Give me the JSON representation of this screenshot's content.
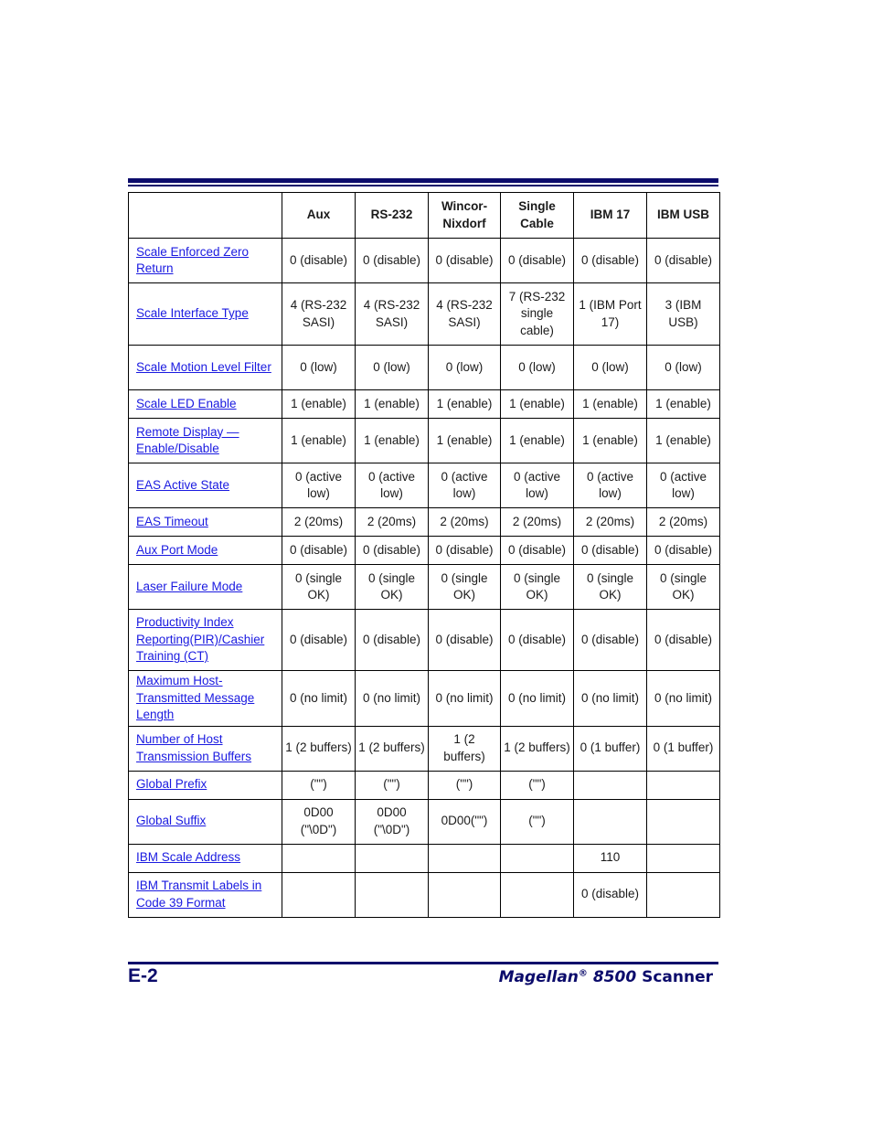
{
  "table": {
    "columns": [
      "",
      "Aux",
      "RS-232",
      "Wincor-\nNixdorf",
      "Single\nCable",
      "IBM 17",
      "IBM USB"
    ],
    "rows": [
      {
        "name": "Scale Enforced Zero Return",
        "values": [
          "0 (disable)",
          "0 (disable)",
          "0 (disable)",
          "0 (disable)",
          "0 (disable)",
          "0 (disable)"
        ]
      },
      {
        "name": "Scale Interface Type",
        "values": [
          "4 (RS-232 SASI)",
          "4 (RS-232 SASI)",
          "4 (RS-232 SASI)",
          "7 (RS-232 single cable)",
          "1 (IBM Port 17)",
          "3 (IBM USB)"
        ]
      },
      {
        "name": "Scale Motion Level Filter",
        "values": [
          "0 (low)",
          "0 (low)",
          "0 (low)",
          "0 (low)",
          "0 (low)",
          "0 (low)"
        ]
      },
      {
        "name": "Scale LED Enable",
        "values": [
          "1 (enable)",
          "1 (enable)",
          "1 (enable)",
          "1 (enable)",
          "1 (enable)",
          "1 (enable)"
        ]
      },
      {
        "name": "Remote Display — Enable/Disable",
        "values": [
          "1 (enable)",
          "1 (enable)",
          "1 (enable)",
          "1 (enable)",
          "1 (enable)",
          "1 (enable)"
        ]
      },
      {
        "name": "EAS Active State",
        "values": [
          "0 (active low)",
          "0 (active low)",
          "0 (active low)",
          "0 (active low)",
          "0 (active low)",
          "0 (active low)"
        ]
      },
      {
        "name": "EAS Timeout",
        "values": [
          "2 (20ms)",
          "2 (20ms)",
          "2 (20ms)",
          "2 (20ms)",
          "2 (20ms)",
          "2 (20ms)"
        ]
      },
      {
        "name": "Aux Port Mode",
        "values": [
          "0 (disable)",
          "0 (disable)",
          "0 (disable)",
          "0 (disable)",
          "0 (disable)",
          "0 (disable)"
        ]
      },
      {
        "name": "Laser Failure Mode",
        "values": [
          "0 (single OK)",
          "0 (single OK)",
          "0 (single OK)",
          "0 (single OK)",
          "0 (single OK)",
          "0 (single OK)"
        ]
      },
      {
        "name": "Productivity Index Reporting(PIR)/Cashier Training (CT)",
        "values": [
          "0 (disable)",
          "0 (disable)",
          "0 (disable)",
          "0 (disable)",
          "0 (disable)",
          "0 (disable)"
        ]
      },
      {
        "name": "Maximum Host-Transmitted Message Length",
        "values": [
          "0 (no limit)",
          "0 (no limit)",
          "0 (no limit)",
          "0 (no limit)",
          "0 (no limit)",
          "0 (no limit)"
        ]
      },
      {
        "name": "Number of Host Transmission Buffers",
        "values": [
          "1 (2 buffers)",
          "1 (2 buffers)",
          "1 (2 buffers)",
          "1 (2 buffers)",
          "0 (1 buffer)",
          "0 (1 buffer)"
        ]
      },
      {
        "name": "Global Prefix",
        "values": [
          "(\"\")",
          "(\"\")",
          "(\"\")",
          "(\"\")",
          "",
          ""
        ]
      },
      {
        "name": "Global Suffix",
        "values": [
          "0D00 (\"\\0D\")",
          "0D00 (\"\\0D\")",
          "0D00(\"\")",
          "(\"\")",
          "",
          ""
        ]
      },
      {
        "name": "IBM Scale Address",
        "values": [
          "",
          "",
          "",
          "",
          "110",
          ""
        ]
      },
      {
        "name": "IBM Transmit Labels in Code 39 Format",
        "values": [
          "",
          "",
          "",
          "",
          "0 (disable)",
          ""
        ]
      }
    ]
  },
  "footer": {
    "page_number": "E-2",
    "title_italic": "Magellan",
    "title_reg": "®",
    "title_model": "8500",
    "title_suffix": "Scanner"
  }
}
